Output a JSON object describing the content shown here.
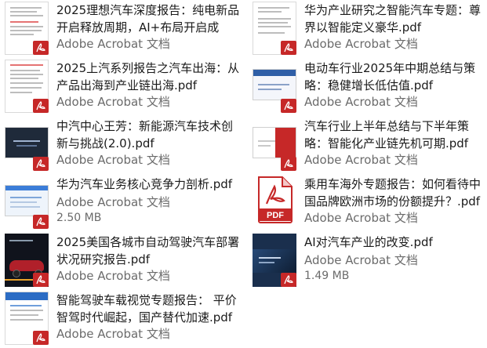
{
  "files": [
    {
      "title": "2025理想汽车深度报告：纯电新品开启释放周期，AI+布局开启成长...",
      "source": "Adobe Acrobat 文档",
      "size": null,
      "thumb": "doc"
    },
    {
      "title": "华为产业研究之智能汽车专题：尊界以智能定义豪华.pdf",
      "source": "Adobe Acrobat 文档",
      "size": null,
      "thumb": "doc"
    },
    {
      "title": "2025上汽系列报告之汽车出海：从产品出海到产业链出海.pdf",
      "source": "Adobe Acrobat 文档",
      "size": null,
      "thumb": "doc"
    },
    {
      "title": "电动车行业2025年中期总结与策略：稳健增长低估值.pdf",
      "source": "Adobe Acrobat 文档",
      "size": null,
      "thumb": "slide-blue"
    },
    {
      "title": "中汽中心王芳：新能源汽车技术创新与挑战(2.0).pdf",
      "source": "Adobe Acrobat 文档",
      "size": null,
      "thumb": "slide-dark"
    },
    {
      "title": "汽车行业上半年总结与下半年策略：智能化产业链先机可期.pdf",
      "source": "Adobe Acrobat 文档",
      "size": null,
      "thumb": "slide-red"
    },
    {
      "title": "华为汽车业务核心竞争力剖析.pdf",
      "source": "Adobe Acrobat 文档",
      "size": "2.50 MB",
      "thumb": "slide-blue2"
    },
    {
      "title": "乘用车海外专题报告：如何看待中国品牌欧洲市场的份额提升？.pdf",
      "source": "Adobe Acrobat 文档",
      "size": null,
      "thumb": "pdf-icon"
    },
    {
      "title": "2025美国各城市自动驾驶汽车部署状况研究报告.pdf",
      "source": "Adobe Acrobat 文档",
      "size": null,
      "thumb": "car"
    },
    {
      "title": "AI对汽车产业的改变.pdf",
      "source": "Adobe Acrobat 文档",
      "size": "1.49 MB",
      "thumb": "tech"
    },
    {
      "title": "智能驾驶车载视觉专题报告： 平价智驾时代崛起，国产替代加速.pdf",
      "source": "Adobe Acrobat 文档",
      "size": null,
      "thumb": "doc-blue"
    }
  ],
  "pdf_icon_label": "PDF",
  "colors": {
    "accent": "#c62828",
    "text": "#1a1a1a",
    "muted": "#6b6b6b"
  }
}
